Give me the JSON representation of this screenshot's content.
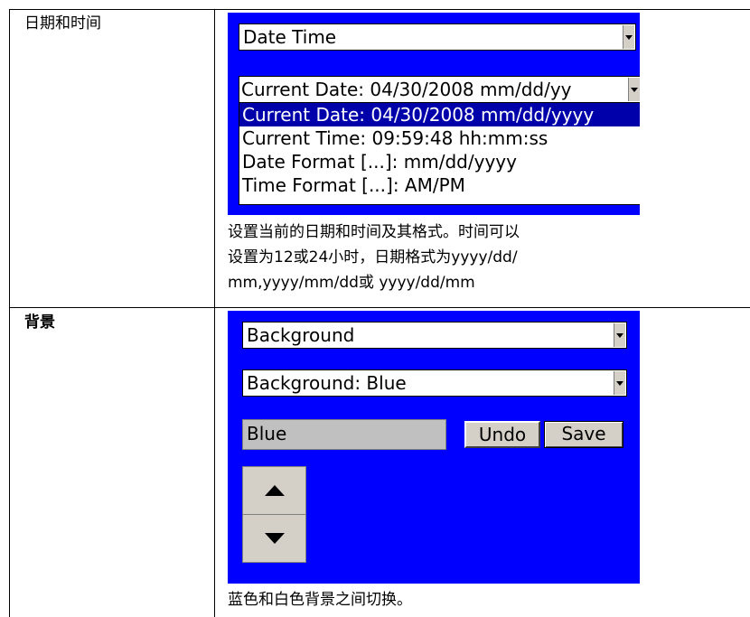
{
  "rows": [
    {
      "label": "日期和时间",
      "screen": {
        "combo": "Date Time",
        "list_header": "Current Date: 04/30/2008 mm/dd/yy",
        "list_items": [
          "Current Date: 04/30/2008 mm/dd/yyyy",
          "Current Time: 09:59:48 hh:mm:ss",
          "Date Format [...]: mm/dd/yyyy",
          "Time Format [...]: AM/PM"
        ],
        "selected_index": 0
      },
      "description": [
        "设置当前的日期和时间及其格式。时间可以",
        "设置为12或24小时，日期格式为yyyy/dd/",
        "mm,yyyy/mm/dd或 yyyy/dd/mm"
      ]
    },
    {
      "label": "背景",
      "screen": {
        "combo1": "Background",
        "combo2": "Background: Blue",
        "value": "Blue",
        "undo_label": "Undo",
        "save_label": "Save",
        "up_icon": "triangle-up-icon",
        "down_icon": "triangle-down-icon"
      },
      "description": [
        "蓝色和白色背景之间切换。"
      ]
    }
  ],
  "colors": {
    "screen_bg": "#0000ff",
    "selection": "#0000aa",
    "button_face": "#d4d0c8"
  }
}
